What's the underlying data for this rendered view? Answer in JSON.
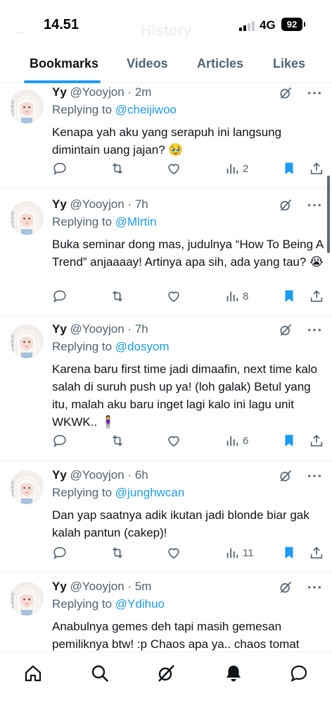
{
  "status_bar": {
    "time": "14.51",
    "network": "4G",
    "battery": "92"
  },
  "header": {
    "ghost_title": "History"
  },
  "tabs": [
    {
      "label": "Bookmarks",
      "active": true
    },
    {
      "label": "Videos",
      "active": false
    },
    {
      "label": "Articles",
      "active": false
    },
    {
      "label": "Likes",
      "active": false
    }
  ],
  "posts": [
    {
      "name": "Yy",
      "handle": "@Yooyjon",
      "dot": "·",
      "time": "2m",
      "reply_prefix": "Replying to",
      "reply_to": "@cheijiwoo",
      "text": "Kenapa yah aku yang serapuh ini langsung dimintain uang jajan? 🥹",
      "views": "2",
      "bookmarked": true
    },
    {
      "name": "Yy",
      "handle": "@Yooyjon",
      "dot": "·",
      "time": "7h",
      "reply_prefix": "Replying to",
      "reply_to": "@Mlrtin",
      "text": "Buka seminar dong mas, judulnya “How To Being A Trend” anjaaaay! Artinya apa sih, ada yang tau? 😭",
      "views": "8",
      "bookmarked": true
    },
    {
      "name": "Yy",
      "handle": "@Yooyjon",
      "dot": "·",
      "time": "7h",
      "reply_prefix": "Replying to",
      "reply_to": "@dosyom",
      "text": "Karena baru first time jadi dimaafin, next time kalo salah di suruh push up ya! (loh galak) Betul yang itu, malah aku baru inget lagi kalo ini lagu unit WKWK.. 🧍‍♀️",
      "views": "6",
      "bookmarked": true
    },
    {
      "name": "Yy",
      "handle": "@Yooyjon",
      "dot": "·",
      "time": "6h",
      "reply_prefix": "Replying to",
      "reply_to": "@junghwcan",
      "text": "Dan yap saatnya adik ikutan jadi blonde biar gak kalah pantun (cakep)!",
      "views": "11",
      "bookmarked": true
    },
    {
      "name": "Yy",
      "handle": "@Yooyjon",
      "dot": "·",
      "time": "5m",
      "reply_prefix": "Replying to",
      "reply_to": "@Ydihuo",
      "text": "Anabulnya gemes deh tapi masih gemesan pemiliknya btw! :p Chaos apa ya.. chaos tomat",
      "views": "",
      "bookmarked": true
    }
  ],
  "colors": {
    "accent": "#1d9bf0",
    "text": "#0f1419",
    "muted": "#536471"
  },
  "icons": {
    "actions": [
      "reply-icon",
      "retweet-icon",
      "like-icon",
      "views-icon",
      "bookmark-icon",
      "share-icon"
    ],
    "nav": [
      "home-icon",
      "search-icon",
      "grok-icon",
      "notifications-icon",
      "messages-icon"
    ]
  }
}
